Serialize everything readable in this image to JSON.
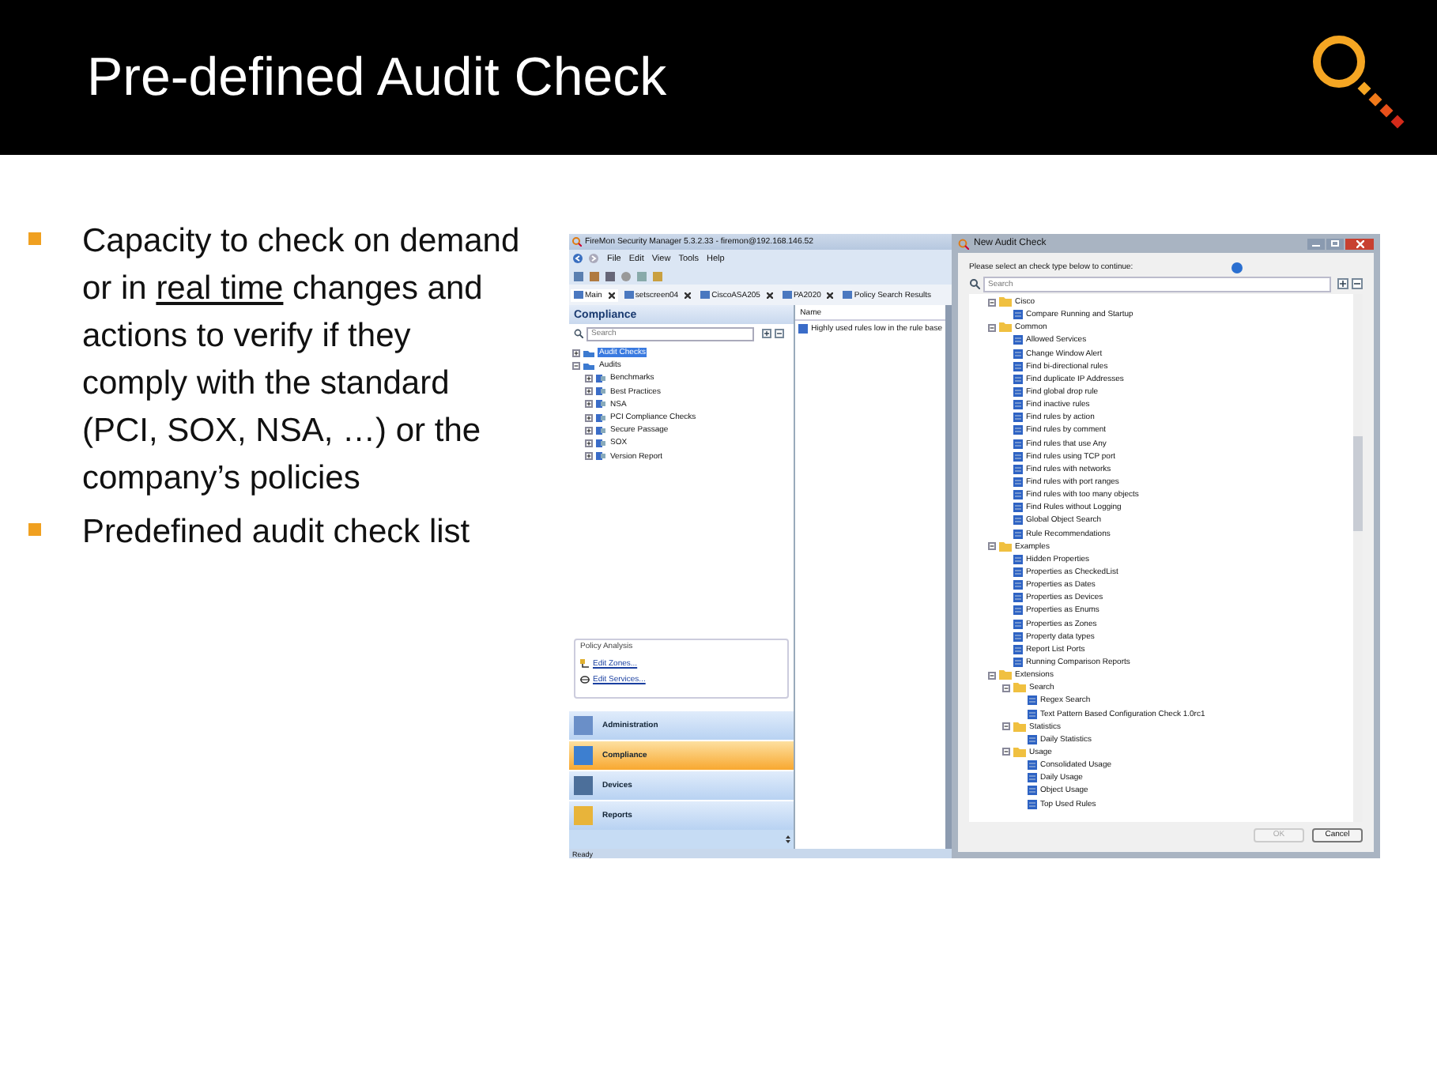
{
  "slide": {
    "title": "Pre-defined Audit Check",
    "bullets": [
      {
        "parts": [
          {
            "text": "Capacity to check on demand or in ",
            "underline": false
          },
          {
            "text": "real time",
            "underline": true
          },
          {
            "text": " changes and actions to verify if they comply with the standard (PCI, SOX, NSA, …) or the company’s policies",
            "underline": false
          }
        ]
      },
      {
        "parts": [
          {
            "text": "Predefined audit check list",
            "underline": false
          }
        ]
      }
    ]
  },
  "app": {
    "title": "FireMon Security Manager 5.3.2.33 - firemon@192.168.146.52",
    "menu": [
      "File",
      "Edit",
      "View",
      "Tools",
      "Help"
    ],
    "tabs": [
      {
        "label": "Main",
        "selected": true
      },
      {
        "label": "setscreen04",
        "selected": false
      },
      {
        "label": "CiscoASA205",
        "selected": false
      },
      {
        "label": "PA2020",
        "selected": false
      },
      {
        "label": "Policy Search Results",
        "selected": false
      }
    ],
    "panel": {
      "title": "Compliance",
      "search": {
        "placeholder": "Search"
      },
      "tree": [
        {
          "label": "Audit Checks",
          "kind": "folder",
          "expanded": false,
          "selected": true
        },
        {
          "label": "Audits",
          "kind": "folder",
          "expanded": true,
          "selected": false,
          "children": [
            {
              "label": "Benchmarks",
              "kind": "audit",
              "expanded": false,
              "selected": false
            },
            {
              "label": "Best Practices",
              "kind": "audit",
              "expanded": false,
              "selected": false
            },
            {
              "label": "NSA",
              "kind": "audit",
              "expanded": false,
              "selected": false
            },
            {
              "label": "PCI Compliance Checks",
              "kind": "audit",
              "expanded": false,
              "selected": false
            },
            {
              "label": "Secure Passage",
              "kind": "audit",
              "expanded": false,
              "selected": false
            },
            {
              "label": "SOX",
              "kind": "audit",
              "expanded": false,
              "selected": false
            },
            {
              "label": "Version Report",
              "kind": "audit",
              "expanded": false,
              "selected": false
            }
          ]
        }
      ]
    },
    "policy_analysis": {
      "title": "Policy Analysis",
      "links": [
        {
          "label": "Edit Zones...",
          "kind": "zones"
        },
        {
          "label": "Edit Services...",
          "kind": "services"
        }
      ]
    },
    "nav": [
      {
        "label": "Administration",
        "selected": false,
        "kind": "admin"
      },
      {
        "label": "Compliance",
        "selected": true,
        "kind": "compliance"
      },
      {
        "label": "Devices",
        "selected": false,
        "kind": "devices"
      },
      {
        "label": "Reports",
        "selected": false,
        "kind": "reports"
      }
    ],
    "list": {
      "column": "Name",
      "rows": [
        "Highly used rules low in the rule base"
      ]
    },
    "status_bar": "Ready"
  },
  "dialog": {
    "title": "New Audit Check",
    "prompt": "Please select an check type below to continue:",
    "search": {
      "placeholder": "Search"
    },
    "tree": [
      {
        "label": "Cisco",
        "kind": "folder",
        "expanded": true,
        "children": [
          {
            "label": "Compare Running and Startup",
            "kind": "check"
          }
        ]
      },
      {
        "label": "Common",
        "kind": "folder",
        "expanded": true,
        "children": [
          {
            "label": "Allowed Services",
            "kind": "check"
          },
          {
            "label": "Change Window Alert",
            "kind": "check"
          },
          {
            "label": "Find bi-directional rules",
            "kind": "check"
          },
          {
            "label": "Find duplicate IP Addresses",
            "kind": "check"
          },
          {
            "label": "Find global drop rule",
            "kind": "check"
          },
          {
            "label": "Find inactive rules",
            "kind": "check"
          },
          {
            "label": "Find rules by action",
            "kind": "check"
          },
          {
            "label": "Find rules by comment",
            "kind": "check"
          },
          {
            "label": "Find rules that use Any",
            "kind": "check"
          },
          {
            "label": "Find rules using TCP port",
            "kind": "check"
          },
          {
            "label": "Find rules with networks",
            "kind": "check"
          },
          {
            "label": "Find rules with port ranges",
            "kind": "check"
          },
          {
            "label": "Find rules with too many objects",
            "kind": "check"
          },
          {
            "label": "Find Rules without Logging",
            "kind": "check"
          },
          {
            "label": "Global Object Search",
            "kind": "check"
          },
          {
            "label": "Rule Recommendations",
            "kind": "check"
          }
        ]
      },
      {
        "label": "Examples",
        "kind": "folder",
        "expanded": true,
        "children": [
          {
            "label": "Hidden Properties",
            "kind": "check"
          },
          {
            "label": "Properties as CheckedList",
            "kind": "check"
          },
          {
            "label": "Properties as Dates",
            "kind": "check"
          },
          {
            "label": "Properties as Devices",
            "kind": "check"
          },
          {
            "label": "Properties as Enums",
            "kind": "check"
          },
          {
            "label": "Properties as Zones",
            "kind": "check"
          },
          {
            "label": "Property data types",
            "kind": "check"
          },
          {
            "label": "Report List Ports",
            "kind": "check"
          },
          {
            "label": "Running Comparison Reports",
            "kind": "check"
          }
        ]
      },
      {
        "label": "Extensions",
        "kind": "folder",
        "expanded": true,
        "children": [
          {
            "label": "Search",
            "kind": "folder",
            "expanded": true,
            "children": [
              {
                "label": "Regex Search",
                "kind": "check"
              },
              {
                "label": "Text Pattern Based Configuration Check 1.0rc1",
                "kind": "check"
              }
            ]
          },
          {
            "label": "Statistics",
            "kind": "folder",
            "expanded": true,
            "children": [
              {
                "label": "Daily Statistics",
                "kind": "check"
              }
            ]
          },
          {
            "label": "Usage",
            "kind": "folder",
            "expanded": true,
            "children": [
              {
                "label": "Consolidated Usage",
                "kind": "check"
              },
              {
                "label": "Daily Usage",
                "kind": "check"
              },
              {
                "label": "Object Usage",
                "kind": "check"
              },
              {
                "label": "Top Used Rules",
                "kind": "check"
              }
            ]
          }
        ]
      }
    ],
    "buttons": [
      {
        "label": "OK",
        "disabled": true
      },
      {
        "label": "Cancel",
        "disabled": false
      }
    ]
  }
}
